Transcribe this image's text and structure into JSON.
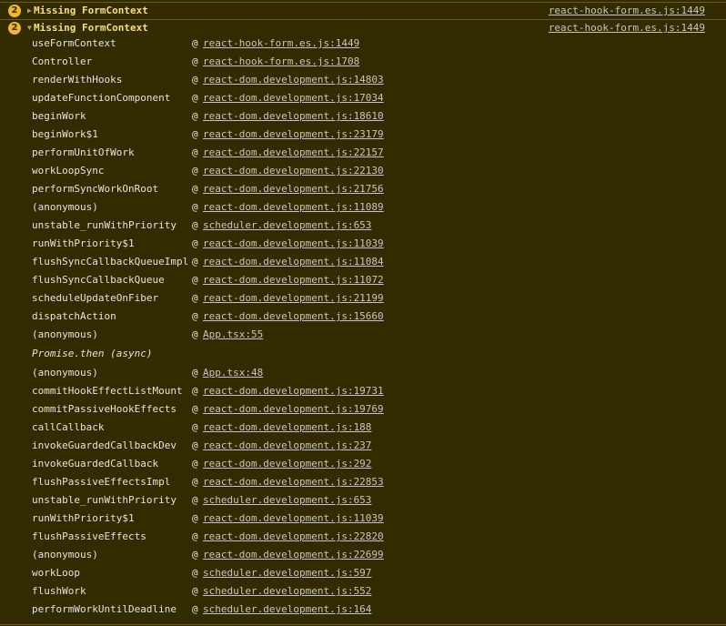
{
  "console": {
    "messages": [
      {
        "count": "2",
        "expanded": false,
        "text": "Missing FormContext",
        "link": "react-hook-form.es.js:1449"
      },
      {
        "count": "2",
        "expanded": true,
        "text": "Missing FormContext",
        "link": "react-hook-form.es.js:1449"
      }
    ],
    "stack_before": [
      {
        "fn": "useFormContext",
        "loc": "react-hook-form.es.js:1449"
      },
      {
        "fn": "Controller",
        "loc": "react-hook-form.es.js:1708"
      },
      {
        "fn": "renderWithHooks",
        "loc": "react-dom.development.js:14803"
      },
      {
        "fn": "updateFunctionComponent",
        "loc": "react-dom.development.js:17034"
      },
      {
        "fn": "beginWork",
        "loc": "react-dom.development.js:18610"
      },
      {
        "fn": "beginWork$1",
        "loc": "react-dom.development.js:23179"
      },
      {
        "fn": "performUnitOfWork",
        "loc": "react-dom.development.js:22157"
      },
      {
        "fn": "workLoopSync",
        "loc": "react-dom.development.js:22130"
      },
      {
        "fn": "performSyncWorkOnRoot",
        "loc": "react-dom.development.js:21756"
      },
      {
        "fn": "(anonymous)",
        "loc": "react-dom.development.js:11089"
      },
      {
        "fn": "unstable_runWithPriority",
        "loc": "scheduler.development.js:653"
      },
      {
        "fn": "runWithPriority$1",
        "loc": "react-dom.development.js:11039"
      },
      {
        "fn": "flushSyncCallbackQueueImpl",
        "loc": "react-dom.development.js:11084"
      },
      {
        "fn": "flushSyncCallbackQueue",
        "loc": "react-dom.development.js:11072"
      },
      {
        "fn": "scheduleUpdateOnFiber",
        "loc": "react-dom.development.js:21199"
      },
      {
        "fn": "dispatchAction",
        "loc": "react-dom.development.js:15660"
      },
      {
        "fn": "(anonymous)",
        "loc": "App.tsx:55"
      }
    ],
    "async_label": "Promise.then (async)",
    "stack_after": [
      {
        "fn": "(anonymous)",
        "loc": "App.tsx:48"
      },
      {
        "fn": "commitHookEffectListMount",
        "loc": "react-dom.development.js:19731"
      },
      {
        "fn": "commitPassiveHookEffects",
        "loc": "react-dom.development.js:19769"
      },
      {
        "fn": "callCallback",
        "loc": "react-dom.development.js:188"
      },
      {
        "fn": "invokeGuardedCallbackDev",
        "loc": "react-dom.development.js:237"
      },
      {
        "fn": "invokeGuardedCallback",
        "loc": "react-dom.development.js:292"
      },
      {
        "fn": "flushPassiveEffectsImpl",
        "loc": "react-dom.development.js:22853"
      },
      {
        "fn": "unstable_runWithPriority",
        "loc": "scheduler.development.js:653"
      },
      {
        "fn": "runWithPriority$1",
        "loc": "react-dom.development.js:11039"
      },
      {
        "fn": "flushPassiveEffects",
        "loc": "react-dom.development.js:22820"
      },
      {
        "fn": "(anonymous)",
        "loc": "react-dom.development.js:22699"
      },
      {
        "fn": "workLoop",
        "loc": "scheduler.development.js:597"
      },
      {
        "fn": "flushWork",
        "loc": "scheduler.development.js:552"
      },
      {
        "fn": "performWorkUntilDeadline",
        "loc": "scheduler.development.js:164"
      }
    ],
    "at_symbol": "@",
    "icons": {
      "collapsed": "triangle-right-icon",
      "expanded": "triangle-down-icon"
    },
    "colors": {
      "background": "#332b00",
      "badge": "#f2b72a",
      "message_text": "#f7df7a",
      "link": "#c8c4bd"
    }
  }
}
